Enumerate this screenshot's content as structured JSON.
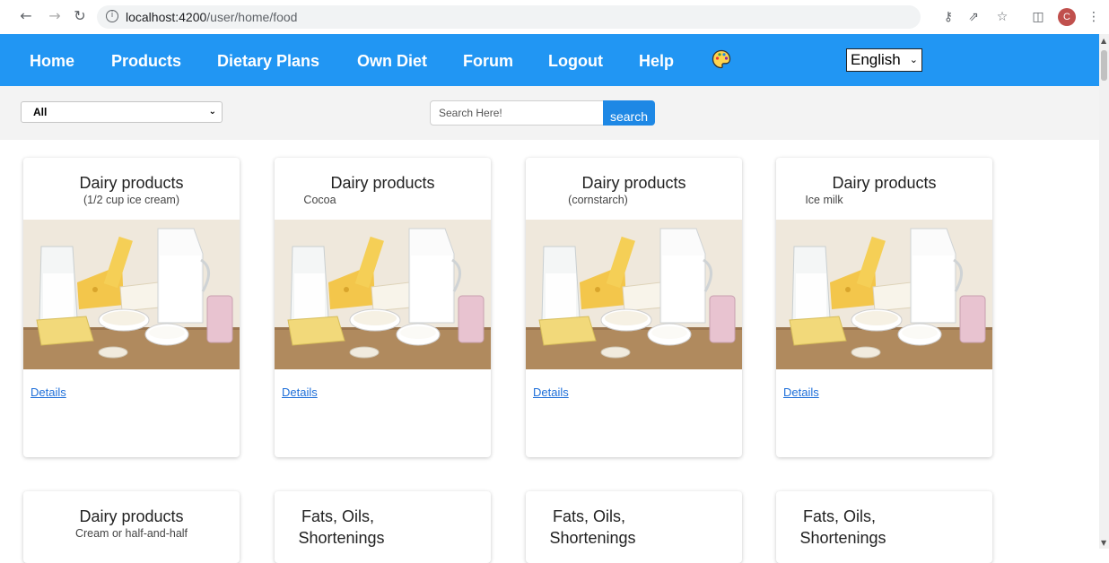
{
  "browser": {
    "url_host": "localhost:4200",
    "url_path": "/user/home/food",
    "avatar_letter": "C"
  },
  "nav": {
    "items": [
      "Home",
      "Products",
      "Dietary Plans",
      "Own Diet",
      "Forum",
      "Logout",
      "Help"
    ],
    "language": "English"
  },
  "filter": {
    "category": "All",
    "search_placeholder": "Search Here!",
    "search_button": "search"
  },
  "cards": [
    {
      "title": "Dairy products",
      "subtitle": "(1/2 cup ice cream)",
      "link": "Details"
    },
    {
      "title": "Dairy products",
      "subtitle": "Cocoa",
      "link": "Details"
    },
    {
      "title": "Dairy products",
      "subtitle": "(cornstarch)",
      "link": "Details"
    },
    {
      "title": "Dairy products",
      "subtitle": "Ice milk",
      "link": "Details"
    },
    {
      "title": "Dairy products",
      "subtitle": "Cream or half-and-half"
    },
    {
      "title": "Fats, Oils,",
      "title2": "Shortenings"
    },
    {
      "title": "Fats, Oils,",
      "title2": "Shortenings"
    },
    {
      "title": "Fats, Oils,",
      "title2": "Shortenings"
    }
  ],
  "colors": {
    "navbar": "#2196f3",
    "search_button": "#1e88e5",
    "link": "#1e6fd9"
  }
}
